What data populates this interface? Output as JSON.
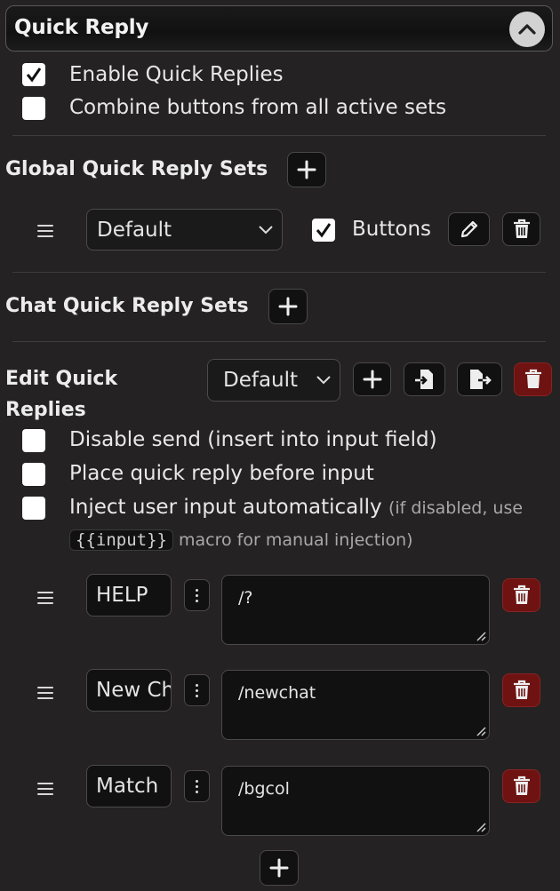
{
  "header": {
    "title": "Quick Reply"
  },
  "options": {
    "enable_label": "Enable Quick Replies",
    "enable_checked": true,
    "combine_label": "Combine buttons from all active sets",
    "combine_checked": false
  },
  "global_sets": {
    "title": "Global Quick Reply Sets",
    "items": [
      {
        "set_name": "Default",
        "buttons_label": "Buttons",
        "buttons_checked": true
      }
    ]
  },
  "chat_sets": {
    "title": "Chat Quick Reply Sets"
  },
  "edit": {
    "title_line1": "Edit Quick",
    "title_line2": "Replies",
    "selected_set": "Default",
    "disable_send_label": "Disable send (insert into input field)",
    "place_before_label": "Place quick reply before input",
    "inject_label": "Inject user input automatically",
    "inject_hint_1": "(if disabled, use",
    "inject_macro": "{{input}}",
    "inject_hint_2": "macro for manual injection)"
  },
  "replies": [
    {
      "label": "HELP",
      "message": "/?"
    },
    {
      "label": "New Chat",
      "message": "/newchat"
    },
    {
      "label": "Match",
      "message": "/bgcol"
    }
  ],
  "colors": {
    "background": "#242222",
    "danger": "#6e1212",
    "button": "#111111"
  }
}
